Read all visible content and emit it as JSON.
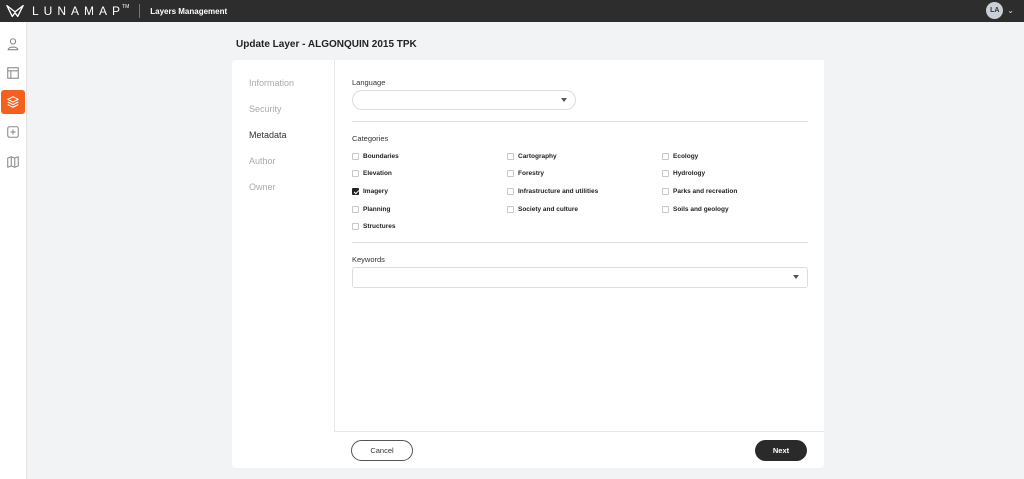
{
  "app": {
    "logo_text": "LUNAMAP",
    "logo_tm": "TM",
    "section_title": "Layers Management",
    "user_initials": "LA"
  },
  "sidebar": {
    "items": [
      {
        "icon": "user-icon",
        "active": false
      },
      {
        "icon": "layout-icon",
        "active": false
      },
      {
        "icon": "layers-icon",
        "active": true
      },
      {
        "icon": "add-icon",
        "active": false
      },
      {
        "icon": "map-icon",
        "active": false
      }
    ],
    "accent_color": "#f5601e"
  },
  "page": {
    "title": "Update Layer - ALGONQUIN 2015 TPK"
  },
  "steps": [
    {
      "label": "Information",
      "active": false
    },
    {
      "label": "Security",
      "active": false
    },
    {
      "label": "Metadata",
      "active": true
    },
    {
      "label": "Author",
      "active": false
    },
    {
      "label": "Owner",
      "active": false
    }
  ],
  "form": {
    "language": {
      "label": "Language",
      "value": ""
    },
    "categories": {
      "label": "Categories",
      "items": [
        {
          "label": "Boundaries",
          "checked": false
        },
        {
          "label": "Cartography",
          "checked": false
        },
        {
          "label": "Ecology",
          "checked": false
        },
        {
          "label": "Elevation",
          "checked": false
        },
        {
          "label": "Forestry",
          "checked": false
        },
        {
          "label": "Hydrology",
          "checked": false
        },
        {
          "label": "Imagery",
          "checked": true
        },
        {
          "label": "Infrastructure and utilities",
          "checked": false
        },
        {
          "label": "Parks and recreation",
          "checked": false
        },
        {
          "label": "Planning",
          "checked": false
        },
        {
          "label": "Society and culture",
          "checked": false
        },
        {
          "label": "Soils and geology",
          "checked": false
        },
        {
          "label": "Structures",
          "checked": false
        }
      ]
    },
    "keywords": {
      "label": "Keywords",
      "value": ""
    }
  },
  "footer": {
    "cancel_label": "Cancel",
    "next_label": "Next"
  }
}
